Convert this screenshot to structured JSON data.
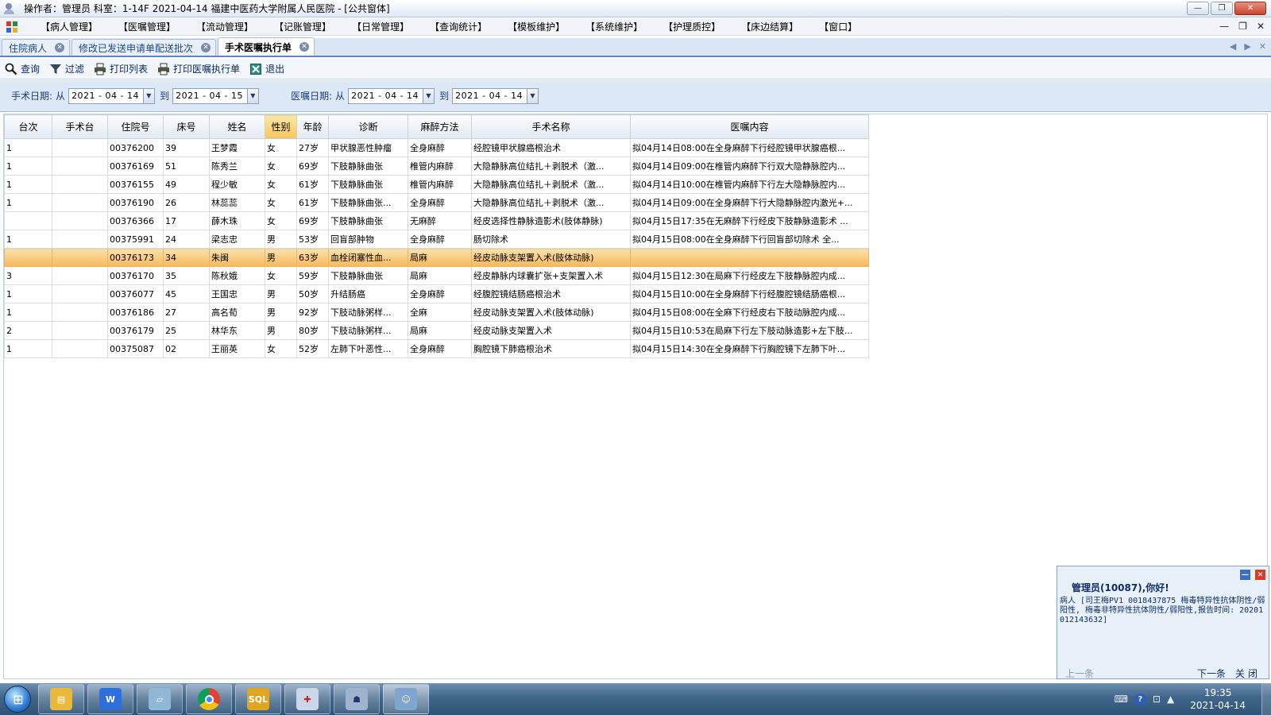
{
  "window": {
    "title": "操作者：管理员   科室：1-14F   2021-04-14   福建中医药大学附属人民医院 - [公共窗体]"
  },
  "menu": {
    "items": [
      "【病人管理】",
      "【医嘱管理】",
      "【流动管理】",
      "【记账管理】",
      "【日常管理】",
      "【查询统计】",
      "【模板维护】",
      "【系统维护】",
      "【护理质控】",
      "【床边结算】",
      "【窗口】"
    ]
  },
  "tabs": [
    {
      "label": "住院病人"
    },
    {
      "label": "修改已发送申请单配送批次"
    },
    {
      "label": "手术医嘱执行单"
    }
  ],
  "toolbar": {
    "query": "查询",
    "filter": "过滤",
    "print_list": "打印列表",
    "print_exec": "打印医嘱执行单",
    "exit": "退出"
  },
  "filter": {
    "surgery_label": "手术日期:",
    "from": "从",
    "to": "到",
    "surgery_from": "2021 - 04 - 14",
    "surgery_to": "2021 - 04 - 15",
    "order_label": "医嘱日期:",
    "order_from": "2021 - 04 - 14",
    "order_to": "2021 - 04 - 14"
  },
  "grid": {
    "columns": [
      "台次",
      "手术台",
      "住院号",
      "床号",
      "姓名",
      "性别",
      "年龄",
      "诊断",
      "麻醉方法",
      "手术名称",
      "医嘱内容"
    ],
    "rows": [
      [
        "1",
        "",
        "00376200",
        "39",
        "王梦霞",
        "女",
        "27岁",
        "甲状腺恶性肿瘤",
        "全身麻醉",
        "经腔镜甲状腺癌根治术",
        "拟04月14日08:00在全身麻醉下行经腔镜甲状腺癌根..."
      ],
      [
        "1",
        "",
        "00376169",
        "51",
        "陈秀兰",
        "女",
        "69岁",
        "下肢静脉曲张",
        "椎管内麻醉",
        "大隐静脉高位结扎＋剥脱术（激...",
        "拟04月14日09:00在椎管内麻醉下行双大隐静脉腔内..."
      ],
      [
        "1",
        "",
        "00376155",
        "49",
        "程少敏",
        "女",
        "61岁",
        "下肢静脉曲张",
        "椎管内麻醉",
        "大隐静脉高位结扎＋剥脱术（激...",
        "拟04月14日10:00在椎管内麻醉下行左大隐静脉腔内..."
      ],
      [
        "1",
        "",
        "00376190",
        "26",
        "林蕊蕊",
        "女",
        "61岁",
        "下肢静脉曲张...",
        "全身麻醉",
        "大隐静脉高位结扎＋剥脱术（激...",
        "拟04月14日09:00在全身麻醉下行大隐静脉腔内激光+..."
      ],
      [
        "",
        "",
        "00376366",
        "17",
        "薛木珠",
        "女",
        "69岁",
        "下肢静脉曲张",
        "无麻醉",
        "经皮选择性静脉造影术(肢体静脉)",
        "拟04月15日17:35在无麻醉下行经皮下肢静脉造影术 ..."
      ],
      [
        "1",
        "",
        "00375991",
        "24",
        "梁志忠",
        "男",
        "53岁",
        "回盲部肿物",
        "全身麻醉",
        "肠切除术",
        "拟04月15日08:00在全身麻醉下行回盲部切除术    全..."
      ],
      [
        "",
        "",
        "00376173",
        "34",
        "朱闽",
        "男",
        "63岁",
        "血栓闭塞性血...",
        "局麻",
        "经皮动脉支架置入术(肢体动脉)",
        ""
      ],
      [
        "3",
        "",
        "00376170",
        "35",
        "陈秋娥",
        "女",
        "59岁",
        "下肢静脉曲张",
        "局麻",
        "经皮静脉内球囊扩张+支架置入术",
        "拟04月15日12:30在局麻下行经皮左下肢静脉腔内成..."
      ],
      [
        "1",
        "",
        "00376077",
        "45",
        "王国忠",
        "男",
        "50岁",
        "升结肠癌",
        "全身麻醉",
        "经腹腔镜结肠癌根治术",
        "拟04月15日10:00在全身麻醉下行经腹腔镜结肠癌根..."
      ],
      [
        "1",
        "",
        "00376186",
        "27",
        "高名荀",
        "男",
        "92岁",
        "下肢动脉粥样...",
        "全麻",
        "经皮动脉支架置入术(肢体动脉)",
        "拟04月15日08:00在全麻下行经皮右下肢动脉腔内成..."
      ],
      [
        "2",
        "",
        "00376179",
        "25",
        "林华东",
        "男",
        "80岁",
        "下肢动脉粥样...",
        "局麻",
        "经皮动脉支架置入术",
        "拟04月15日10:53在局麻下行左下肢动脉造影+左下肢..."
      ],
      [
        "1",
        "",
        "00375087",
        "02",
        "王丽英",
        "女",
        "52岁",
        "左肺下叶恶性...",
        "全身麻醉",
        "胸腔镜下肺癌根治术",
        "拟04月15日14:30在全身麻醉下行胸腔镜下左肺下叶..."
      ]
    ]
  },
  "popup": {
    "title": "管理员(10087),你好!",
    "body": "病人 [司王梅PV1 0018437875 梅毒特异性抗体阴性/弱阳性, 梅毒非特异性抗体阴性/弱阳性,报告时间: 20201012143632]",
    "prev": "上一条",
    "next": "下一条",
    "close": "关闭"
  },
  "taskbar": {
    "time": "19:35",
    "date": "2021-04-14"
  }
}
